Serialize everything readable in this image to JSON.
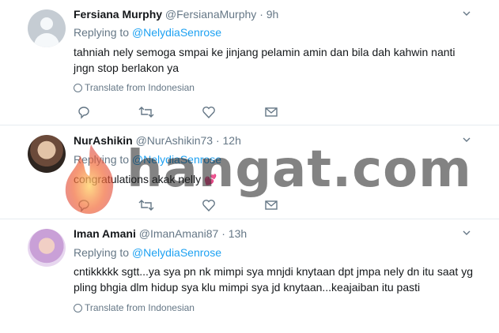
{
  "tweets": [
    {
      "name": "Fersiana Murphy",
      "handle": "@FersianaMurphy",
      "dot": "·",
      "time": "9h",
      "replying_prefix": "Replying to ",
      "replying_to": "@NelydiaSenrose",
      "text": "tahniah nely semoga smpai ke jinjang pelamin amin dan bila dah kahwin nanti jngn stop berlakon ya",
      "translate": "Translate from Indonesian",
      "avatar": "default-avatar"
    },
    {
      "name": "NurAshikin",
      "handle": "@NurAshikin73",
      "dot": "·",
      "time": "12h",
      "replying_prefix": "Replying to ",
      "replying_to": "@NelydiaSenrose",
      "text": "congratulations akak nelly",
      "emoji": "💕",
      "avatar": "photo"
    },
    {
      "name": "Iman Amani",
      "handle": "@ImanAmani87",
      "dot": "·",
      "time": "13h",
      "replying_prefix": "Replying to ",
      "replying_to": "@NelydiaSenrose",
      "text": "cntikkkkk sgtt...ya sya pn nk mimpi sya mnjdi knytaan dpt jmpa nely dn itu saat yg pling bhgia dlm hidup sya klu mimpi sya jd knytaan...keajaiban itu pasti",
      "translate": "Translate from Indonesian",
      "avatar": "photo"
    }
  ],
  "watermark": {
    "text": "hangat.com"
  },
  "colors": {
    "link": "#1da1f2",
    "muted": "#657786",
    "text": "#14171a",
    "divider": "#e6ecf0"
  },
  "icons": [
    "reply-icon",
    "retweet-icon",
    "like-icon",
    "message-icon",
    "caret-down-icon",
    "globe-icon"
  ]
}
